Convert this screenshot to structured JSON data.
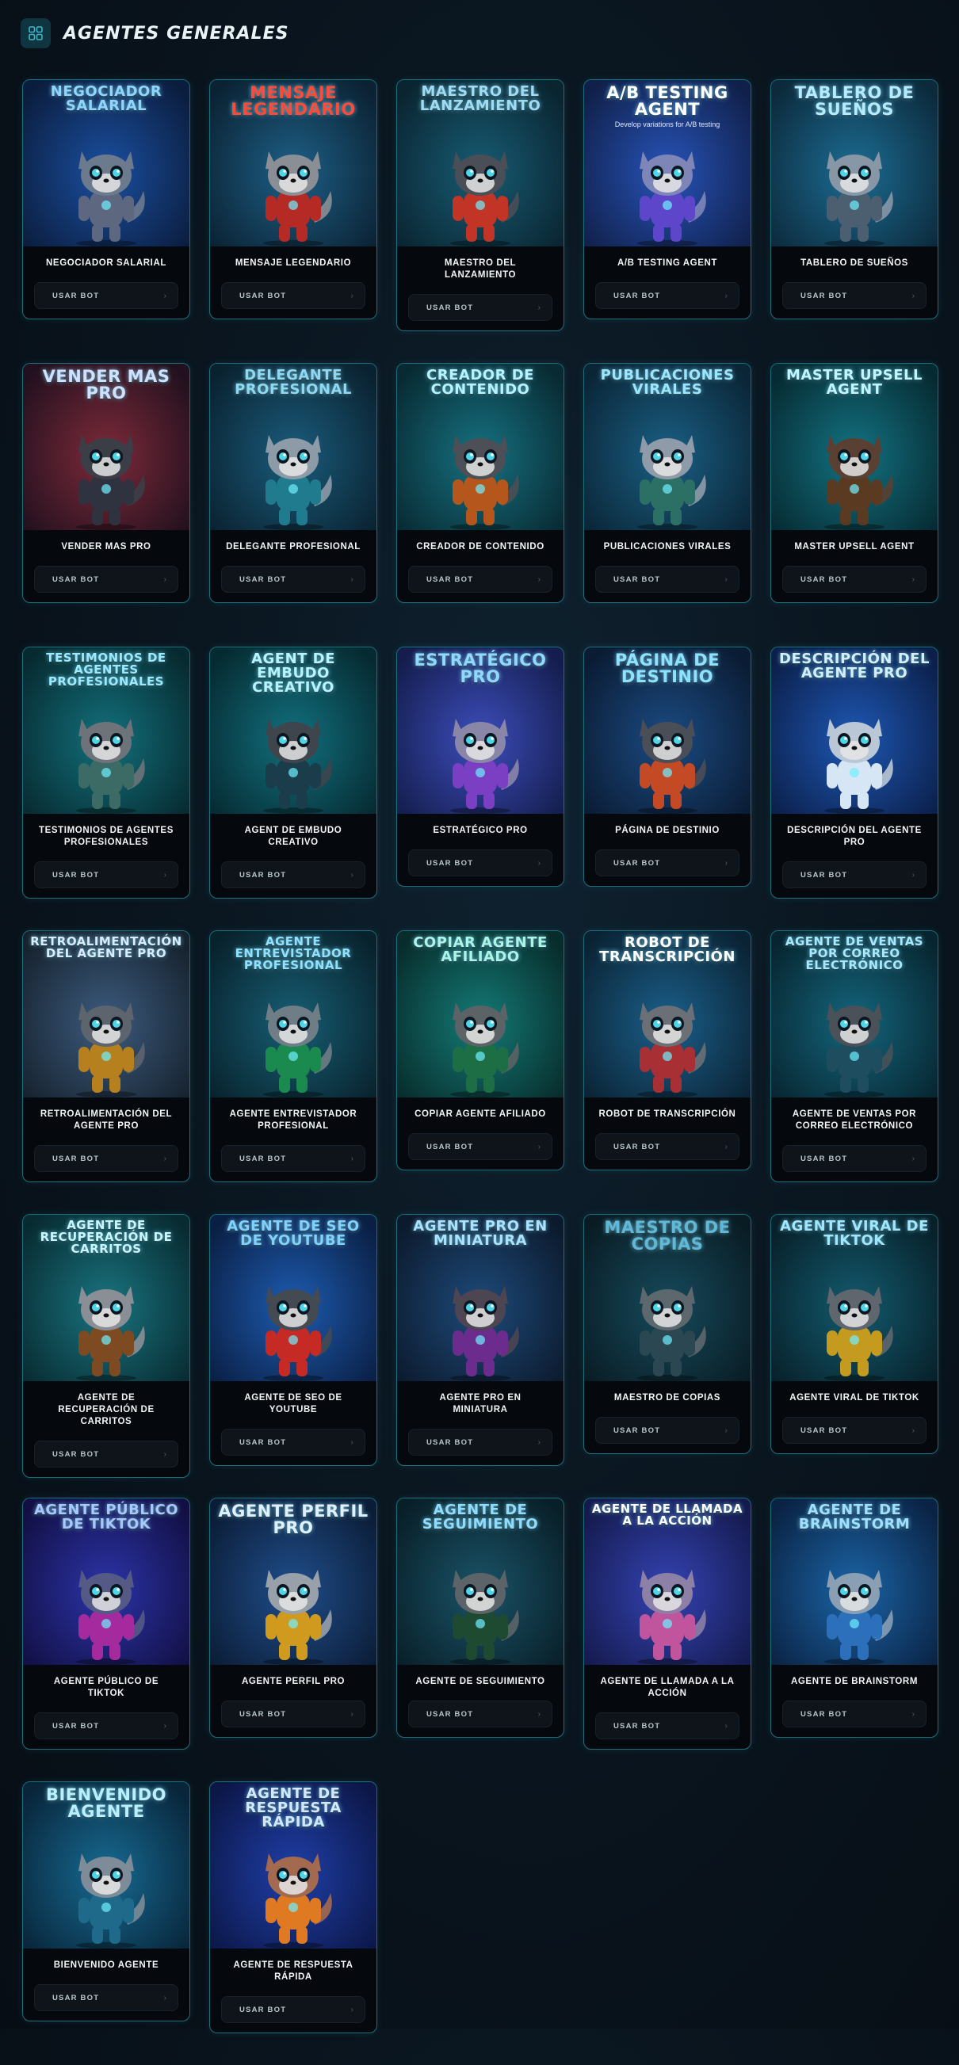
{
  "header": {
    "title": "AGENTES GENERALES",
    "icon": "grid-icon"
  },
  "button_label": "USAR BOT",
  "cards": [
    {
      "art": "NEGOCIADOR SALARIAL",
      "name": "NEGOCIADOR SALARIAL",
      "bg": "#1a4fa0",
      "bg2": "#0b1d3e",
      "title_color": "#8fd6ff",
      "suit": "#5d6880",
      "fur": "#6c7a8e",
      "offset": 0
    },
    {
      "art": "MENSAJE LEGENDARIO",
      "name": "MENSAJE LEGENDARIO",
      "bg": "#1d5f86",
      "bg2": "#0b2233",
      "title_color": "#ff4a3a",
      "suit": "#b52a25",
      "fur": "#8a8f96",
      "offset": 0
    },
    {
      "art": "MAESTRO DEL LANZAMIENTO",
      "name": "MAESTRO DEL LANZAMIENTO",
      "bg": "#175c74",
      "bg2": "#0a2430",
      "title_color": "#9fdcf4",
      "suit": "#c13426",
      "fur": "#4a4f57",
      "offset": 0
    },
    {
      "art": "A/B TESTING AGENT",
      "sub": "Develop variations for A/B testing",
      "name": "A/B TESTING AGENT",
      "bg": "#2753b8",
      "bg2": "#10204a",
      "title_color": "#ffffff",
      "suit": "#5d46c9",
      "fur": "#7e86b8",
      "offset": 0
    },
    {
      "art": "TABLERO DE SUEÑOS",
      "name": "TABLERO DE SUEÑOS",
      "bg": "#1c6c93",
      "bg2": "#0c2a3c",
      "title_color": "#b6eaff",
      "suit": "#4c5f70",
      "fur": "#8797a6",
      "offset": 0
    },
    {
      "art": "VENDER MAS PRO",
      "name": "VENDER MAS PRO",
      "bg": "#7d2a39",
      "bg2": "#22101e",
      "title_color": "#cfe1ff",
      "suit": "#2f3340",
      "fur": "#3b3e47",
      "offset": -6
    },
    {
      "art": "DELEGANTE PROFESIONAL",
      "name": "DELEGANTE PROFESIONAL",
      "bg": "#1a5c7c",
      "bg2": "#0a2230",
      "title_color": "#8fd8f2",
      "suit": "#1f7b8d",
      "fur": "#8d9aa8",
      "offset": 0
    },
    {
      "art": "CREADOR DE CONTENIDO",
      "name": "CREADOR DE CONTENIDO",
      "bg": "#167181",
      "bg2": "#082a32",
      "title_color": "#b4f3ff",
      "suit": "#b5561c",
      "fur": "#4c4f55",
      "offset": 0
    },
    {
      "art": "PUBLICACIONES VIRALES",
      "name": "PUBLICACIONES VIRALES",
      "bg": "#1a5f84",
      "bg2": "#0a2536",
      "title_color": "#9be6ff",
      "suit": "#2c6f64",
      "fur": "#8f9ba8",
      "offset": 0
    },
    {
      "art": "MASTER UPSELL AGENT",
      "name": "MASTER UPSELL AGENT",
      "bg": "#137282",
      "bg2": "#062a31",
      "title_color": "#bff6ff",
      "suit": "#5b3a22",
      "fur": "#5a4032",
      "offset": 0
    },
    {
      "art": "TESTIMONIOS DE AGENTES PROFESIONALES",
      "name": "TESTIMONIOS DE AGENTES PROFESIONALES",
      "bg": "#12707c",
      "bg2": "#072a30",
      "title_color": "#9aebff",
      "suit": "#3b6b64",
      "fur": "#6d7378",
      "offset": 0
    },
    {
      "art": "AGENT DE EMBUDO CREATIVO",
      "name": "AGENT DE EMBUDO CREATIVO",
      "bg": "#11707e",
      "bg2": "#062a31",
      "title_color": "#b6f4ff",
      "suit": "#1b3c4a",
      "fur": "#3f454c",
      "offset": 0
    },
    {
      "art": "ESTRATÉGICO PRO",
      "name": "ESTRATÉGICO PRO",
      "bg": "#3c4dbb",
      "bg2": "#141d4d",
      "title_color": "#8fd8ff",
      "suit": "#7a3fc2",
      "fur": "#8a86a8",
      "offset": -16
    },
    {
      "art": "PÁGINA DE DESTINIO",
      "name": "PÁGINA DE DESTINIO",
      "bg": "#1b4b82",
      "bg2": "#0a1b33",
      "title_color": "#8de2ff",
      "suit": "#c44a25",
      "fur": "#4a4e56",
      "offset": -16
    },
    {
      "art": "DESCRIPCIÓN DEL AGENTE PRO",
      "name": "DESCRIPCIÓN DEL AGENTE PRO",
      "bg": "#1e57b3",
      "bg2": "#0b1f4a",
      "title_color": "#d3efff",
      "suit": "#d7e6f5",
      "fur": "#b9c7d6",
      "offset": 0
    },
    {
      "art": "RETROALIMENTACIÓN DEL AGENTE PRO",
      "name": "RETROALIMENTACIÓN DEL AGENTE PRO",
      "bg": "#3c5b7e",
      "bg2": "#16222e",
      "title_color": "#d9ecff",
      "suit": "#b6801f",
      "fur": "#5d646d",
      "offset": 0
    },
    {
      "art": "AGENTE ENTREVISTADOR PROFESIONAL",
      "name": "AGENTE ENTREVISTADOR PROFESIONAL",
      "bg": "#175e74",
      "bg2": "#08222c",
      "title_color": "#8fe2ff",
      "suit": "#1b8a4f",
      "fur": "#6f7d86",
      "offset": 0
    },
    {
      "art": "COPIAR AGENTE AFILIADO",
      "name": "COPIAR AGENTE AFILIADO",
      "bg": "#147a76",
      "bg2": "#072c2b",
      "title_color": "#aaf5e8",
      "suit": "#1d6d45",
      "fur": "#5c6366",
      "offset": -16
    },
    {
      "art": "ROBOT DE TRANSCRIPCIÓN",
      "name": "ROBOT DE TRANSCRIPCIÓN",
      "bg": "#1b5f8a",
      "bg2": "#0a2334",
      "title_color": "#ffffff",
      "suit": "#a82f33",
      "fur": "#6b6f76",
      "offset": -16
    },
    {
      "art": "AGENTE DE VENTAS POR CORREO ELECTRÓNICO",
      "name": "AGENTE DE VENTAS POR CORREO ELECTRÓNICO",
      "bg": "#14657c",
      "bg2": "#072530",
      "title_color": "#a6e9ff",
      "suit": "#1d4d5e",
      "fur": "#4a5158",
      "offset": 0
    },
    {
      "art": "AGENTE DE RECUPERACIÓN DE CARRITOS",
      "name": "AGENTE DE RECUPERACIÓN DE CARRITOS",
      "bg": "#197480",
      "bg2": "#082b31",
      "title_color": "#c9f7ff",
      "suit": "#7d4a22",
      "fur": "#8a8f96",
      "offset": 0
    },
    {
      "art": "AGENTE DE SEO DE YOUTUBE",
      "name": "AGENTE DE SEO DE YOUTUBE",
      "bg": "#1d5bb0",
      "bg2": "#0a1f44",
      "title_color": "#7fd1ff",
      "suit": "#c62a25",
      "fur": "#444a52",
      "offset": -16
    },
    {
      "art": "AGENTE PRO EN MINIATURA",
      "name": "AGENTE PRO EN MINIATURA",
      "bg": "#1d4a7a",
      "bg2": "#0c1a2d",
      "title_color": "#a9e2ff",
      "suit": "#6b2c8e",
      "fur": "#4d4552",
      "offset": -16
    },
    {
      "art": "MAESTRO DE COPIAS",
      "name": "MAESTRO DE COPIAS",
      "bg": "#164a5c",
      "bg2": "#091c24",
      "title_color": "#5fb8d8",
      "suit": "#2b4752",
      "fur": "#5d676e",
      "offset": -16
    },
    {
      "art": "AGENTE VIRAL DE TIKTOK",
      "name": "AGENTE VIRAL DE TIKTOK",
      "bg": "#135a6e",
      "bg2": "#072029",
      "title_color": "#9fe7ff",
      "suit": "#c49a1f",
      "fur": "#5f666d",
      "offset": -16
    },
    {
      "art": "AGENTE PÚBLICO DE TIKTOK",
      "name": "AGENTE PÚBLICO DE TIKTOK",
      "bg": "#2b34a8",
      "bg2": "#120f44",
      "title_color": "#a8c7ff",
      "suit": "#a42a9e",
      "fur": "#545a85",
      "offset": 0
    },
    {
      "art": "AGENTE PERFIL PRO",
      "name": "AGENTE PERFIL PRO",
      "bg": "#1f4e8b",
      "bg2": "#0b1c36",
      "title_color": "#dff0ff",
      "suit": "#d09a1e",
      "fur": "#98a0aa",
      "offset": 0
    },
    {
      "art": "AGENTE DE SEGUIMIENTO",
      "name": "AGENTE DE SEGUIMIENTO",
      "bg": "#1a5368",
      "bg2": "#081f28",
      "title_color": "#8fdcff",
      "suit": "#1f4a32",
      "fur": "#5d6469",
      "offset": 0
    },
    {
      "art": "AGENTE DE LLAMADA A LA ACCIÓN",
      "name": "AGENTE DE LLAMADA A LA ACCIÓN",
      "bg": "#3443b3",
      "bg2": "#141a4d",
      "title_color": "#ffffff",
      "suit": "#c0559e",
      "fur": "#8c80a6",
      "offset": 0
    },
    {
      "art": "AGENTE DE BRAINSTORM",
      "name": "AGENTE DE BRAINSTORM",
      "bg": "#1b64a6",
      "bg2": "#0a2344",
      "title_color": "#9fdfff",
      "suit": "#2c6fba",
      "fur": "#8a9fb3",
      "offset": 0
    },
    {
      "art": "BIENVENIDO AGENTE",
      "name": "BIENVENIDO AGENTE",
      "bg": "#176a92",
      "bg2": "#08253a",
      "title_color": "#b9efff",
      "suit": "#1f6a8a",
      "fur": "#7d8c98",
      "offset": 0
    },
    {
      "art": "AGENTE DE RESPUESTA RÁPIDA",
      "name": "AGENTE DE RESPUESTA RÁPIDA",
      "bg": "#1f3fa8",
      "bg2": "#0c1748",
      "title_color": "#d3e8ff",
      "suit": "#e07a22",
      "fur": "#a36a4f",
      "offset": 0
    }
  ]
}
